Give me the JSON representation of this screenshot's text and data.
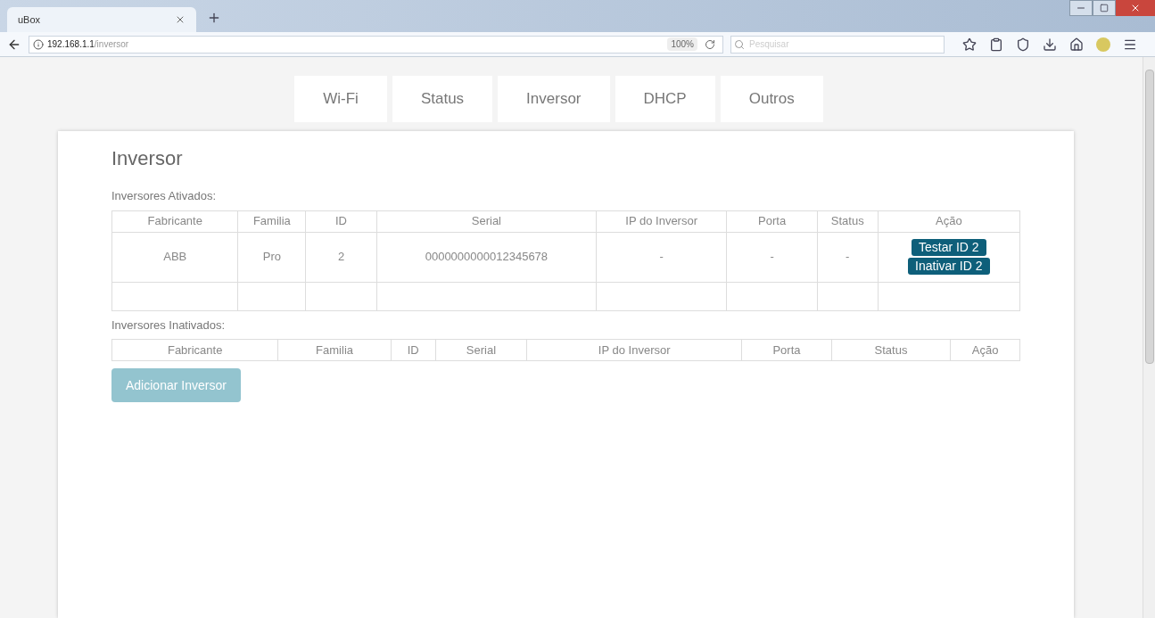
{
  "browser": {
    "tab_title": "uBox",
    "url_host": "192.168.1.1",
    "url_path": "/inversor",
    "zoom": "100%",
    "search_placeholder": "Pesquisar"
  },
  "nav_tabs": [
    "Wi-Fi",
    "Status",
    "Inversor",
    "DHCP",
    "Outros"
  ],
  "page_title": "Inversor",
  "active_section": {
    "title": "Inversores Ativados:",
    "columns": [
      "Fabricante",
      "Familia",
      "ID",
      "Serial",
      "IP do Inversor",
      "Porta",
      "Status",
      "Ação"
    ],
    "rows": [
      {
        "cells": [
          "ABB",
          "Pro",
          "2",
          "0000000000012345678",
          "-",
          "-",
          "-"
        ],
        "actions": [
          "Testar ID 2",
          "Inativar ID 2"
        ]
      }
    ]
  },
  "inactive_section": {
    "title": "Inversores Inativados:",
    "columns": [
      "Fabricante",
      "Familia",
      "ID",
      "Serial",
      "IP do Inversor",
      "Porta",
      "Status",
      "Ação"
    ]
  },
  "add_button": {
    "label": "Adicionar Inversor",
    "disabled": true
  }
}
